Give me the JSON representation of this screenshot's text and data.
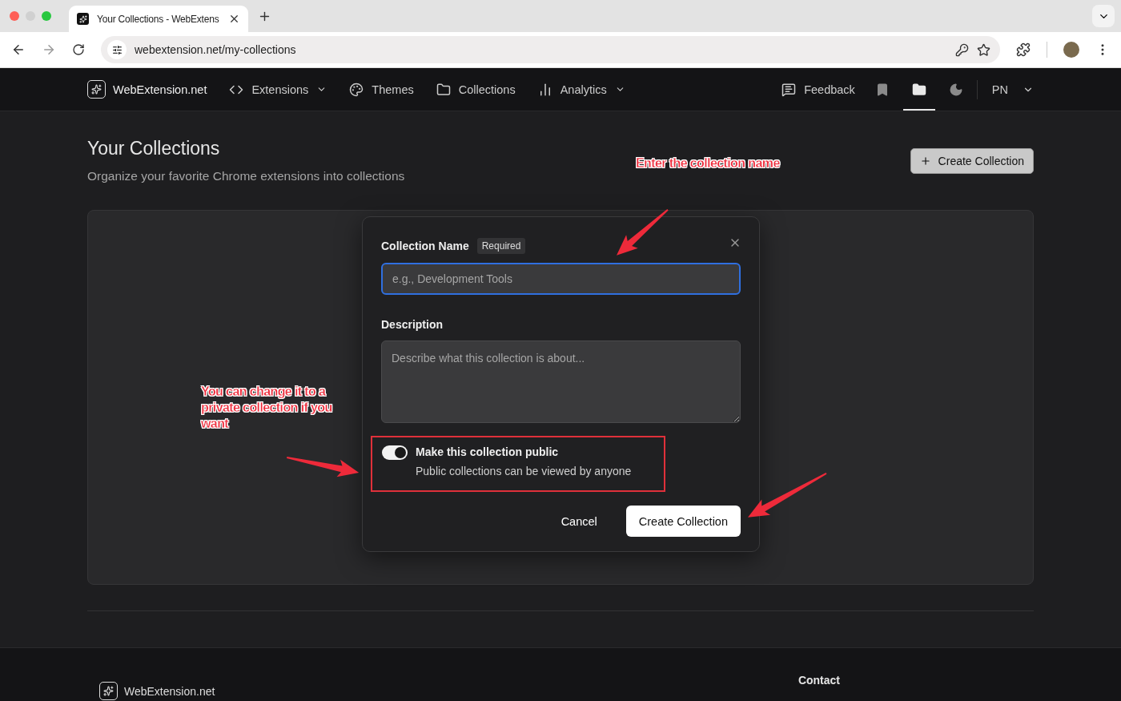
{
  "browser": {
    "tab_title": "Your Collections - WebExtens",
    "url": "webextension.net/my-collections"
  },
  "nav": {
    "brand": "WebExtension.net",
    "links": [
      {
        "label": "Extensions",
        "dropdown": true
      },
      {
        "label": "Themes",
        "dropdown": false
      },
      {
        "label": "Collections",
        "dropdown": false
      },
      {
        "label": "Analytics",
        "dropdown": true
      }
    ],
    "feedback": "Feedback",
    "icon_buttons": [
      {
        "selected": false
      },
      {
        "selected": true
      },
      {
        "selected": false
      }
    ],
    "user": "PN"
  },
  "page": {
    "title": "Your Collections",
    "subtitle": "Organize your favorite Chrome extensions into collections",
    "create_button": "Create Collection"
  },
  "dialog": {
    "name_label": "Collection Name",
    "required_badge": "Required",
    "name_placeholder": "e.g., Development Tools",
    "description_label": "Description",
    "description_placeholder": "Describe what this collection is about...",
    "public_toggle": {
      "label": "Make this collection public",
      "hint": "Public collections can be viewed by anyone",
      "on": true
    },
    "cancel": "Cancel",
    "submit": "Create Collection"
  },
  "annotations": [
    {
      "text": "Enter the collection name"
    },
    {
      "text": "You can change it to a private collection if you want"
    }
  ],
  "footer": {
    "brand": "WebExtension.net",
    "contact_heading": "Contact"
  }
}
